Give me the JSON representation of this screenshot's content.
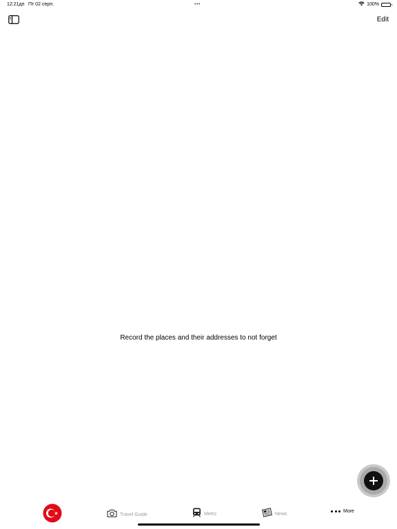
{
  "status_bar": {
    "time": "12:21дп",
    "date": "Пт 02 серп.",
    "multitask_dots": "•••",
    "battery": "100%",
    "battery_level": 1.0
  },
  "nav": {
    "edit_label": "Edit",
    "sidebar_icon": "sidebar-toggle-icon"
  },
  "main": {
    "empty_message": "Record the places and their addresses to not forget"
  },
  "fab": {
    "icon": "plus-icon"
  },
  "tab_bar": {
    "tabs": [
      {
        "icon": "turkey-flag-icon",
        "label": "",
        "active": true
      },
      {
        "icon": "camera-icon",
        "label": "Travel Guide",
        "active": false
      },
      {
        "icon": "metro-train-icon",
        "label": "Metro",
        "active": false
      },
      {
        "icon": "newspaper-icon",
        "label": "News",
        "active": false
      },
      {
        "icon": "more-dots-icon",
        "label": "More",
        "active": false
      }
    ]
  },
  "colors": {
    "flag_red": "#e30a17",
    "tab_inactive": "#9a9a9a",
    "fab_background": "#111111"
  }
}
